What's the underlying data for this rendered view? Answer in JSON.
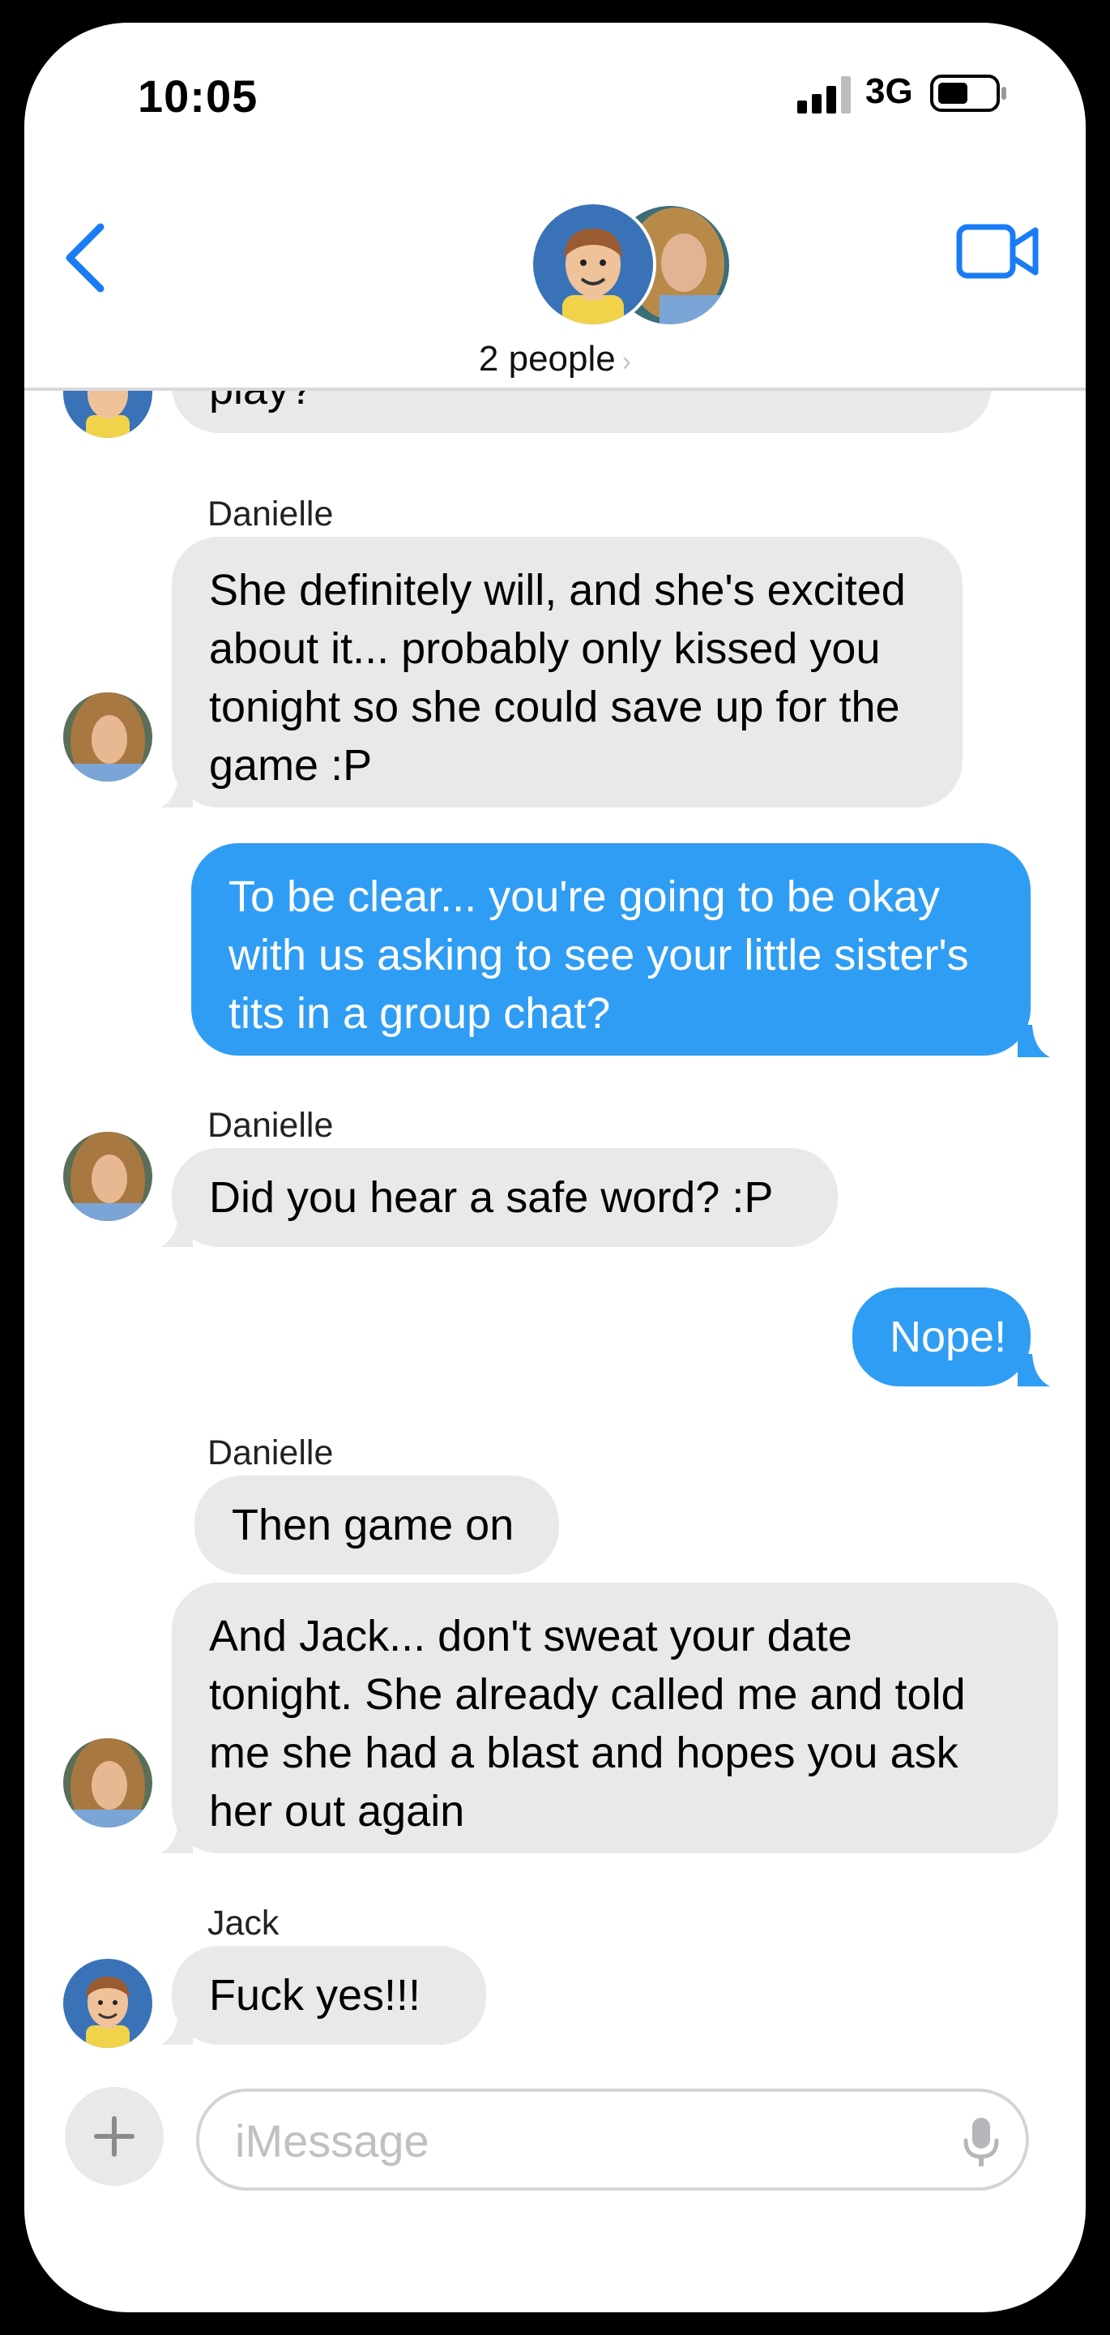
{
  "status_bar": {
    "time": "10:05",
    "network": "3G"
  },
  "header": {
    "title": "2 people",
    "chevron": "›"
  },
  "messages": [
    {
      "type": "in",
      "text_lines": [
        "play?"
      ]
    },
    {
      "type": "in",
      "sender": "Danielle",
      "text_lines": [
        "She definitely will, and she's excited",
        "about it... probably only kissed you",
        "tonight so she could save up for the",
        "game :P"
      ]
    },
    {
      "type": "out",
      "text_lines": [
        "To be clear... you're going to be okay",
        "with us asking to see your little sister's",
        "tits in a group chat?"
      ]
    },
    {
      "type": "in",
      "sender": "Danielle",
      "text_lines": [
        "Did you hear a safe word? :P"
      ]
    },
    {
      "type": "out",
      "text_lines": [
        "Nope!"
      ]
    },
    {
      "type": "in",
      "sender": "Danielle",
      "text_lines": [
        "Then game on"
      ]
    },
    {
      "type": "in",
      "text_lines": [
        "And Jack... don't sweat your date",
        "tonight.  She already called me and told",
        "me she had a blast and hopes you ask",
        "her out again"
      ]
    },
    {
      "type": "in",
      "sender": "Jack",
      "text_lines": [
        "Fuck yes!!!"
      ]
    }
  ],
  "input": {
    "placeholder": "iMessage",
    "value": ""
  },
  "icons": [
    "back-chevron-icon",
    "video-camera-icon",
    "plus-icon",
    "microphone-icon",
    "signal-icon",
    "battery-icon"
  ],
  "colors": {
    "accent": "#2f9df4",
    "incoming_bubble": "#e9e9eb",
    "ios_blue": "#1a7cf5"
  }
}
